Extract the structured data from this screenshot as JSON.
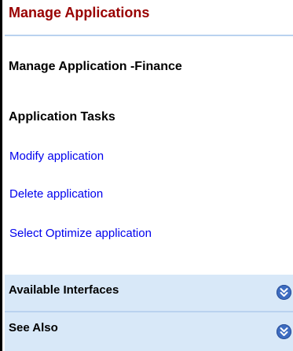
{
  "header": {
    "title": "Manage Applications"
  },
  "application": {
    "title": "Manage Application -Finance"
  },
  "tasks": {
    "heading": "Application Tasks",
    "items": [
      {
        "label": "Modify application"
      },
      {
        "label": "Delete application"
      },
      {
        "label": "Select Optimize application"
      }
    ]
  },
  "sections": [
    {
      "label": "Available Interfaces",
      "icon": "double-chevron-down-icon"
    },
    {
      "label": "See Also",
      "icon": "double-chevron-down-icon"
    }
  ],
  "colors": {
    "title": "#990000",
    "link": "#0000ee",
    "section_background": "#d8e8f8",
    "rule": "#b9d2ef",
    "expand_button": "#3d6cc1"
  }
}
